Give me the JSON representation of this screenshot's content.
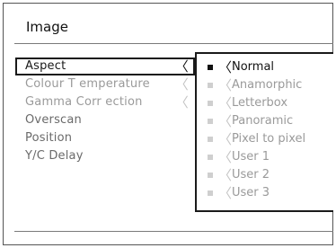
{
  "menu": {
    "title": "Image"
  },
  "left_items": [
    {
      "label": "Aspect",
      "chevron": "〈"
    },
    {
      "label": "Colour T emperature",
      "chevron": "〈"
    },
    {
      "label": "Gamma Corr ection",
      "chevron": "〈"
    },
    {
      "label": "Overscan"
    },
    {
      "label": "Position"
    },
    {
      "label": "Y/C Delay"
    }
  ],
  "submenu": {
    "selected_index": 0,
    "items": [
      {
        "label": "Normal",
        "chevron": "〈"
      },
      {
        "label": "Anamorphic",
        "chevron": "〈"
      },
      {
        "label": "Letterbox",
        "chevron": "〈"
      },
      {
        "label": "Panoramic",
        "chevron": "〈"
      },
      {
        "label": "Pixel to pixel",
        "chevron": "〈"
      },
      {
        "label": "User 1",
        "chevron": "〈"
      },
      {
        "label": "User 2",
        "chevron": "〈"
      },
      {
        "label": "User 3",
        "chevron": "〈"
      }
    ]
  },
  "colors": {
    "text_active": "#111111",
    "text_inactive": "#9a9a9a",
    "border": "#1a1a1a"
  }
}
